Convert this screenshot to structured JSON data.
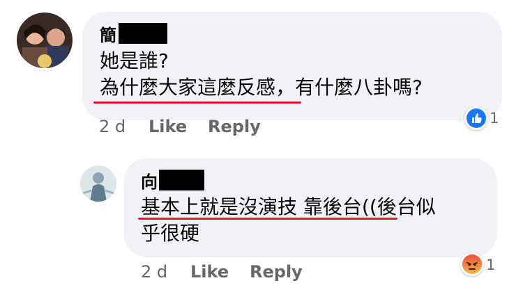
{
  "comment": {
    "author_visible": "簡",
    "lines": [
      "她是誰?",
      "為什麼大家這麼反感，有什麼八卦嗎?"
    ],
    "time": "2 d",
    "like_label": "Like",
    "reply_label": "Reply",
    "reaction": {
      "type": "like",
      "count": "1",
      "color": "#1877f2"
    }
  },
  "reply": {
    "author_visible": "向",
    "lines": [
      "基本上就是沒演技 靠後台((後台似",
      "乎很硬"
    ],
    "time": "2 d",
    "like_label": "Like",
    "reply_label": "Reply",
    "reaction": {
      "type": "angry",
      "count": "1",
      "color": "#f0793f"
    }
  },
  "colors": {
    "bubble": "#f0f2f5",
    "underline": "#e2162c",
    "meta": "#65676b"
  }
}
